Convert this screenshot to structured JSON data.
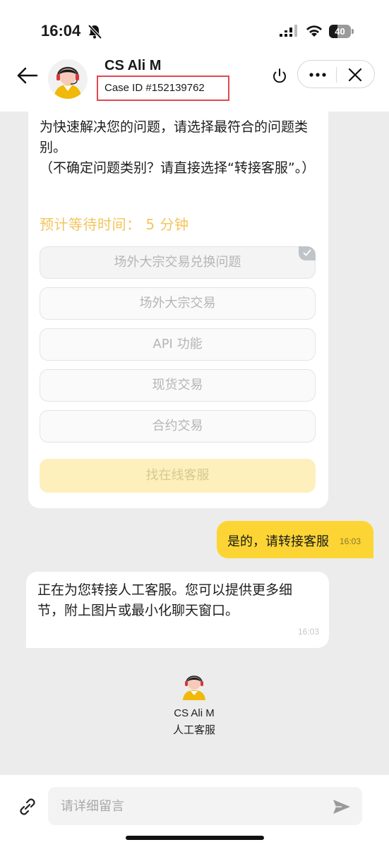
{
  "status_bar": {
    "time": "16:04",
    "battery": "40",
    "battery_level": 0.4
  },
  "header": {
    "agent_name": "CS Ali M",
    "case_id": "Case ID #152139762",
    "icons": [
      "back-arrow-icon",
      "avatar",
      "power-icon",
      "more-icon",
      "close-icon"
    ]
  },
  "intro_message": {
    "line1": "为快速解决您的问题，请选择最符合的问题类别。",
    "line2": "（不确定问题类别？请直接选择“转接客服”。）",
    "wait_time": "预计等待时间：  5 分钟"
  },
  "options": [
    {
      "label": "场外大宗交易兑换问题",
      "selected": true
    },
    {
      "label": "场外大宗交易",
      "selected": false
    },
    {
      "label": "API 功能",
      "selected": false
    },
    {
      "label": "现货交易",
      "selected": false
    },
    {
      "label": "合约交易",
      "selected": false
    }
  ],
  "online_agent_button": "找在线客服",
  "user_message": {
    "text": "是的，请转接客服",
    "time": "16:03"
  },
  "bot_message": {
    "text": "正在为您转接人工客服。您可以提供更多细节，附上图片或最小化聊天窗口。",
    "time": "16:03"
  },
  "agent_card": {
    "name": "CS Ali M",
    "role": "人工客服"
  },
  "composer": {
    "placeholder": "请详细留言"
  },
  "colors": {
    "accent": "#fcd535",
    "wait_time": "#f3c55d",
    "case_box_border": "#e0484e"
  }
}
